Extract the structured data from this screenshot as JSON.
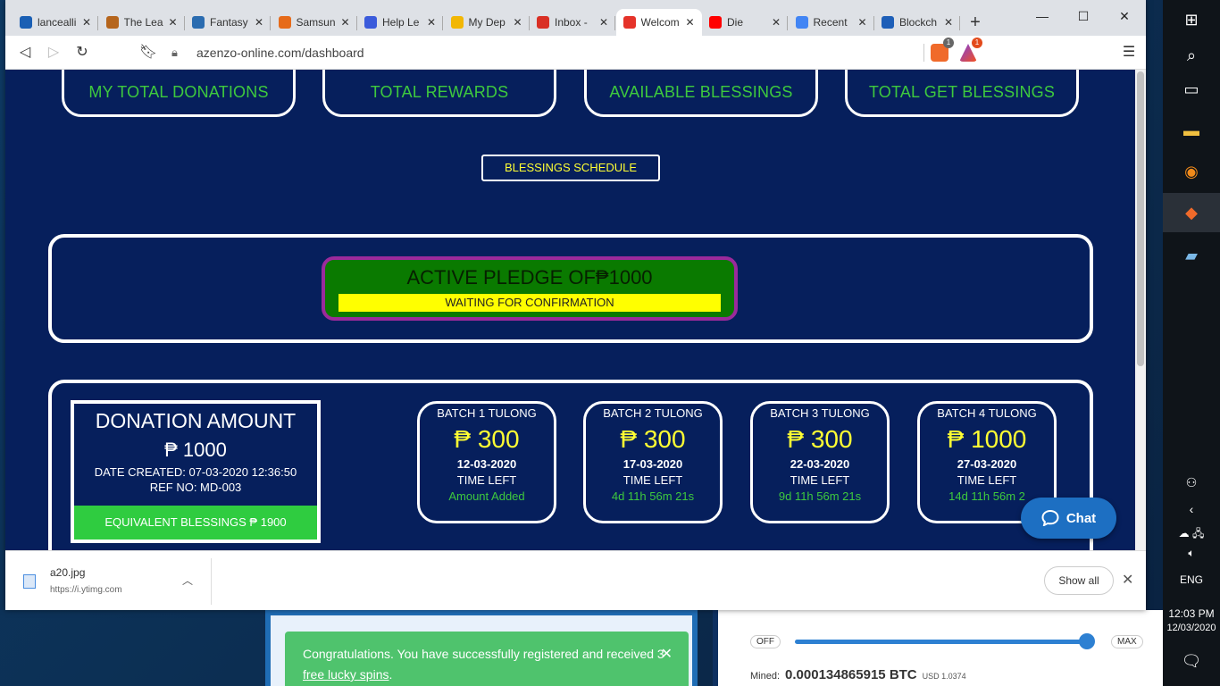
{
  "browser": {
    "tabs": [
      {
        "title": "lancealli",
        "color": "#1a5fb4"
      },
      {
        "title": "The Lea",
        "color": "#b5651d"
      },
      {
        "title": "Fantasy",
        "color": "#2b6cb0"
      },
      {
        "title": "Samsun",
        "color": "#e66b1a"
      },
      {
        "title": "Help Le",
        "color": "#3b5bdb"
      },
      {
        "title": "My Dep",
        "color": "#f2b705"
      },
      {
        "title": "Inbox -",
        "color": "#d93025"
      },
      {
        "title": "Welcom",
        "color": "#e5332a",
        "active": true
      },
      {
        "title": "Die",
        "color": "#ff0000"
      },
      {
        "title": "Recent",
        "color": "#4285f4"
      },
      {
        "title": "Blockch",
        "color": "#1e5fb8"
      }
    ],
    "url": "azenzo-online.com/dashboard",
    "shield_badge": "1",
    "bat_badge": "1"
  },
  "dashboard": {
    "stats": [
      "MY TOTAL DONATIONS",
      "TOTAL REWARDS",
      "AVAILABLE BLESSINGS",
      "TOTAL GET BLESSINGS"
    ],
    "schedule_button": "BLESSINGS SCHEDULE",
    "pledge": {
      "title": "ACTIVE PLEDGE OF₱1000",
      "status": "WAITING FOR CONFIRMATION"
    },
    "donation": {
      "title": "DONATION AMOUNT",
      "amount": "₱ 1000",
      "date_created": "DATE CREATED: 07-03-2020 12:36:50",
      "ref_no": "REF NO: MD-003",
      "equivalent": "EQUIVALENT BLESSINGS ₱ 1900"
    },
    "batches": [
      {
        "name": "BATCH 1 TULONG",
        "amount": "₱ 300",
        "date": "12-03-2020",
        "time_left_label": "TIME LEFT",
        "countdown": "Amount Added"
      },
      {
        "name": "BATCH 2 TULONG",
        "amount": "₱ 300",
        "date": "17-03-2020",
        "time_left_label": "TIME LEFT",
        "countdown": "4d 11h 56m 21s"
      },
      {
        "name": "BATCH 3 TULONG",
        "amount": "₱ 300",
        "date": "22-03-2020",
        "time_left_label": "TIME LEFT",
        "countdown": "9d 11h 56m 21s"
      },
      {
        "name": "BATCH 4 TULONG",
        "amount": "₱ 1000",
        "date": "27-03-2020",
        "time_left_label": "TIME LEFT",
        "countdown": "14d 11h 56m 2"
      }
    ],
    "chat_label": "Chat"
  },
  "downloads": {
    "file_name": "a20.jpg",
    "source": "https://i.ytimg.com",
    "show_all": "Show all"
  },
  "background": {
    "notice_text": "Congratulations. You have successfully registered and received 3",
    "notice_link": "free lucky spins",
    "notice_end": ".",
    "off_label": "OFF",
    "max_label": "MAX",
    "mined_label": "Mined:",
    "mined_value": "0.000134865915 BTC",
    "usd_value": "USD 1.0374"
  },
  "taskbar": {
    "lang": "ENG",
    "time": "12:03 PM",
    "date": "12/03/2020"
  }
}
